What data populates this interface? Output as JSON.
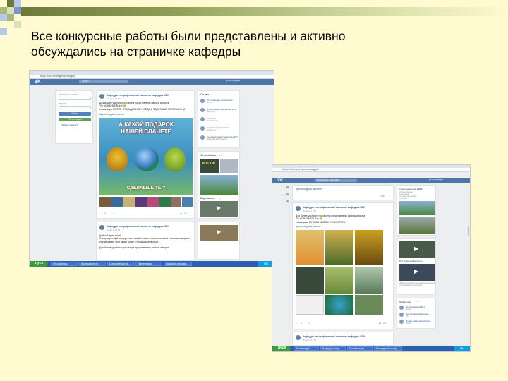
{
  "slide": {
    "title_line1": "Все конкурсные работы были представлены и активно",
    "title_line2": "обсуждались на страничке кафедры"
  },
  "colors": {
    "slide_bg": "#fffad0",
    "vk_blue": "#4a76a8",
    "link": "#2a5885",
    "taskbar": "#2b5fb3",
    "start": "#3c9a3c"
  },
  "shot1": {
    "url": "https://vk.com/kgeoecologiya",
    "header": {
      "logo": "VK",
      "search_placeholder": "Поиск",
      "register": "регистрация"
    },
    "login": {
      "phone_label": "Телефон или email",
      "password_label": "Пароль",
      "login_button": "Войти",
      "register_button": "Регистрация",
      "forgot": "Забыли пароль?"
    },
    "post1": {
      "title": "Кафедра географической экологии кафедры БГУ",
      "date": "Вчера в 17:00",
      "text": [
        "Для Ваших удобной просмотра представлены работы авторов",
        "ТО «ЮНАРМЕЙЦЫ» 😊",
        "Номинация МОТИВ «ГРАЖДАНСКАЯ СРЕДА И ЗДОРОВЫЙ ОБРАЗ ЖИЗНИ»"
      ],
      "hashtag": "#geoecologybsu_contest",
      "banner_top1": "А КАКОЙ ПОДАРОК",
      "banner_top2": "НАШЕЙ ПЛАНЕТЕ",
      "banner_bottom": "СДЕЛАЕШЬ ТЫ?",
      "likes": "6",
      "views": "26"
    },
    "post2": {
      "title": "Кафедра географической экологии кафедры БГУ",
      "date": "Вчера в 17:17",
      "text": [
        "Добрый день всем!",
        "Стимулирующий конкурс на лучший слоган геоэкологической тематики завершен",
        "Награждение этой акции будет в ближайший период..."
      ],
      "subtext": "Для более удобного просмотра представлены работы авторов"
    },
    "side": {
      "links_title": "Ссылки",
      "links": [
        {
          "name": "БГУ Кафедра геоэкологии",
          "sub": "vk.com"
        },
        {
          "name": "Электронная библиотека БГУ",
          "sub": "elib.bsu.by"
        },
        {
          "name": "Facebook",
          "sub": "facebook.com"
        },
        {
          "name": "Сайт географического",
          "sub": "geo.bsu.by"
        },
        {
          "name": "Географический факультет БГУ",
          "sub": "Официальная страница"
        }
      ],
      "albums_title": "Фотоальбомы",
      "albums_count": "10",
      "album_label": "МУСОР",
      "videos_title": "Видеозаписи",
      "videos_count": "2"
    },
    "taskbar": {
      "start": "пуск",
      "tasks": [
        "VK кафедры",
        "Кафедра геогр...",
        "Сохранённые ф...",
        "Презентация",
        "Кафедра географ..."
      ],
      "time": "RU"
    }
  },
  "shot2": {
    "url": "https://vk.com/kgeoecologiya",
    "header": {
      "logo": "VK",
      "search_placeholder": "Кафедры кафедры",
      "register": "регистрация"
    },
    "post0": {
      "hashtag": "#geoecologybsu #контест",
      "count": "136"
    },
    "post1": {
      "title": "Кафедра географической экологии кафедры БГУ",
      "date": "Вчера в 17:17",
      "text": [
        "Для более удобного просмотра представлены работы авторов",
        "ТО «ЮНАРМЕЙЦЫ» 😊",
        "Номинация МУЗЫКА ЧИСТЫХ ГЕОСИСТЕМ"
      ],
      "hashtag": "#geoecologybsu_contest",
      "likes": "6",
      "views": "20"
    },
    "post2": {
      "title": "Кафедра географической экологии кафедры БГУ",
      "date": "Вчера в 17:17"
    },
    "side": {
      "news_title": "Твоя геоэкология в БГУ",
      "news_lines": [
        "15 мая провели",
        "конкурсный",
        "«Геоэкологический»",
        "с 16 мая"
      ],
      "videos_title": "БГУ Кафедра Беларусь",
      "video2_title": "III Международная научная конференция «Современные проблемы»",
      "subs_title": "Подписчики",
      "subs_count": "8",
      "subs": [
        {
          "name": "Ника Сладкова БГУ",
          "sub": "Минск"
        },
        {
          "name": "Ника Сладкова Сладко...",
          "sub": "БГУ"
        },
        {
          "name": "Ирина Смирнова, Кураж",
          "sub": "Минск"
        }
      ]
    },
    "taskbar": {
      "start": "пуск",
      "tasks": [
        "VK кафедры",
        "Кафедра геогр...",
        "Презентация",
        "Кафедра географ..."
      ],
      "time": "RU"
    }
  }
}
